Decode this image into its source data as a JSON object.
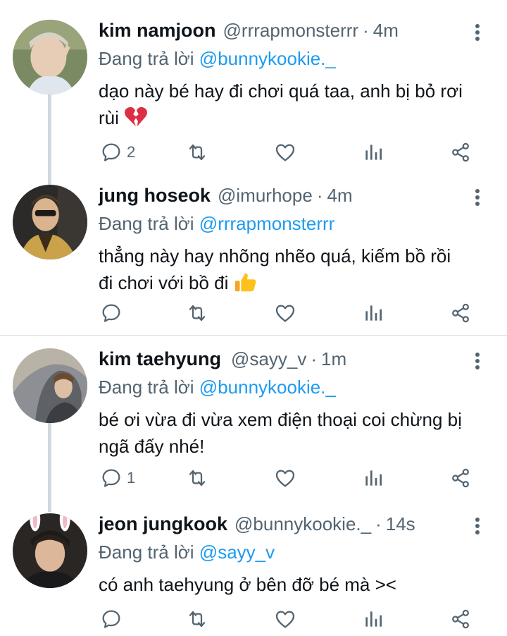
{
  "reply_prefix": "Đang trả lời",
  "separator": "·",
  "colors": {
    "mention": "#1d9bf0",
    "secondary": "#536471",
    "thread_line": "#cfd9de"
  },
  "icons": [
    "reply-icon",
    "retweet-icon",
    "like-icon",
    "views-icon",
    "share-icon",
    "more-icon",
    "broken-heart-emoji",
    "thumbs-up-emoji"
  ],
  "tweets": [
    {
      "name": "kim namjoon",
      "handle": "@rrrapmonsterrr",
      "time": "4m",
      "reply_to": "@bunnykookie._",
      "lines": [
        "dạo này bé hay đi chơi quá taa, anh bị bỏ rơi",
        "rùi"
      ],
      "reply_count": "2"
    },
    {
      "name": "jung hoseok",
      "handle": "@imurhope",
      "time": "4m",
      "reply_to": "@rrrapmonsterrr",
      "lines": [
        "thẳng này hay nhõng nhẽo quá, kiếm bồ rồi",
        "đi chơi với bồ đi"
      ],
      "reply_count": ""
    },
    {
      "name": "kim taehyung",
      "handle": "@sayy_v",
      "time": "1m",
      "reply_to": "@bunnykookie._",
      "lines": [
        "bé ơi vừa đi vừa xem điện thoại coi chừng bị",
        "ngã đấy nhé!"
      ],
      "reply_count": "1"
    },
    {
      "name": "jeon jungkook",
      "handle": "@bunnykookie._",
      "time": "14s",
      "reply_to": "@sayy_v",
      "lines": [
        "có anh taehyung ở bên đỡ bé mà ><"
      ],
      "reply_count": ""
    }
  ]
}
